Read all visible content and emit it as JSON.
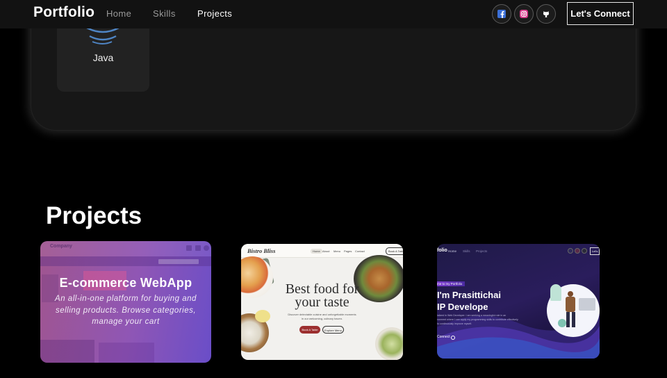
{
  "nav": {
    "brand": "Portfolio",
    "links": [
      {
        "label": "Home",
        "active": false
      },
      {
        "label": "Skills",
        "active": false
      },
      {
        "label": "Projects",
        "active": true
      }
    ],
    "social": [
      "facebook-icon",
      "instagram-icon",
      "github-icon"
    ],
    "cta": "Let's Connect"
  },
  "skills": {
    "items": [
      {
        "label": "Java",
        "icon": "java-icon"
      }
    ]
  },
  "projects": {
    "title": "Projects",
    "cards": [
      {
        "title": "E-commerce WebApp",
        "description": "An all-in-one platform for buying and selling products. Browse categories, manage your cart",
        "preview": {
          "brand": "Company"
        }
      },
      {
        "preview": {
          "brand": "Bistro Bliss",
          "menu": [
            "Home",
            "About",
            "Menu",
            "Pages",
            "Contact"
          ],
          "button": "Book A Table",
          "headline_1": "Best food for",
          "headline_2": "your taste",
          "sub_1": "Discover delectable cuisine and unforgettable moments",
          "sub_2": "in our welcoming, culinary haven.",
          "primary": "Book A Table",
          "secondary": "Explore Menu"
        }
      },
      {
        "preview": {
          "brand": "folio",
          "menu": [
            "Home",
            "Skills",
            "Projects"
          ],
          "cta": "Let's",
          "tag": "me to my Portfolio",
          "headline_1": "I'm Prasittichai",
          "headline_2": "IP Develope",
          "sub_1": "ialized in Web Developer. I am seeking a meaningful role in an",
          "sub_2": "ronment where I can apply my programming skills to contribute effectively",
          "sub_3": "to continuously improve myself.",
          "link": "Connect"
        }
      }
    ]
  },
  "colors": {
    "background": "#000000",
    "navbar": "#121212",
    "panel": "#171717",
    "ecommerce_gradient_start": "#a0558f",
    "ecommerce_gradient_end": "#6a4ec8",
    "bistro_button": "#9c2f2f",
    "portfolio_bg": "#221b50"
  }
}
